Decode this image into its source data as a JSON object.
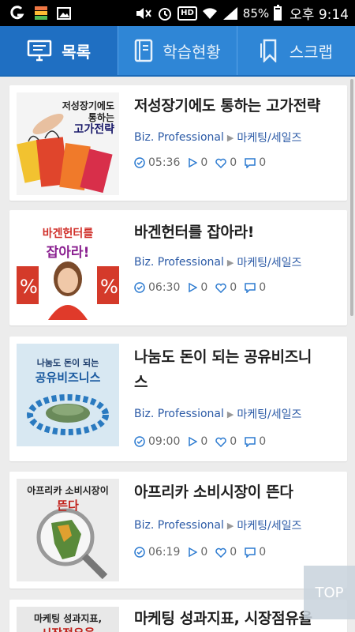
{
  "statusbar": {
    "battery": "85%",
    "battery_level": 0.85,
    "time": "오후 9:14"
  },
  "tabs": [
    {
      "label": "목록",
      "icon": "monitor-icon",
      "active": true
    },
    {
      "label": "학습현황",
      "icon": "book-icon",
      "active": false
    },
    {
      "label": "스크랩",
      "icon": "bookmark-icon",
      "active": false
    }
  ],
  "items": [
    {
      "title": "저성장기에도 통하는 고가전략",
      "thumb_text": [
        "저성장기에도",
        "통하는",
        "고가전략"
      ],
      "category": "Biz. Professional",
      "subcategory": "마케팅/세일즈",
      "duration": "05:36",
      "plays": "0",
      "likes": "0",
      "comments": "0"
    },
    {
      "title": "바겐헌터를 잡아라!",
      "thumb_text": [
        "바겐헌터를",
        "잡아라!"
      ],
      "category": "Biz. Professional",
      "subcategory": "마케팅/세일즈",
      "duration": "06:30",
      "plays": "0",
      "likes": "0",
      "comments": "0"
    },
    {
      "title": "나눔도 돈이 되는 공유비즈니스",
      "title_line1": "나눔도 돈이 되는 공유비즈니",
      "title_line2": "스",
      "thumb_text": [
        "나눔도 돈이 되는",
        "공유비즈니스"
      ],
      "category": "Biz. Professional",
      "subcategory": "마케팅/세일즈",
      "duration": "09:00",
      "plays": "0",
      "likes": "0",
      "comments": "0"
    },
    {
      "title": "아프리카 소비시장이 뜬다",
      "thumb_text": [
        "아프리카 소비시장이",
        "뜬다"
      ],
      "category": "Biz. Professional",
      "subcategory": "마케팅/세일즈",
      "duration": "06:19",
      "plays": "0",
      "likes": "0",
      "comments": "0"
    },
    {
      "title": "마케팅 성과지표, 시장점유율",
      "thumb_text": [
        "마케팅 성과지표,",
        "시장점유율"
      ]
    }
  ],
  "top_button": "TOP",
  "colors": {
    "tab_bg": "#2f86d6",
    "tab_active": "#1f6fc2",
    "link": "#2b5aa6"
  }
}
